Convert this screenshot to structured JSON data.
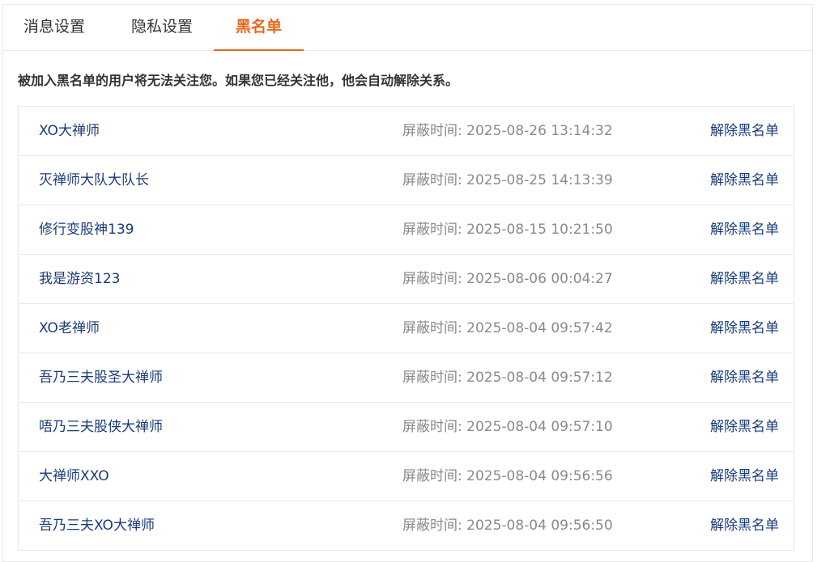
{
  "tabs": [
    {
      "label": "消息设置",
      "active": false
    },
    {
      "label": "隐私设置",
      "active": false
    },
    {
      "label": "黑名单",
      "active": true
    }
  ],
  "notice": "被加入黑名单的用户将无法关注您。如果您已经关注他，他会自动解除关系。",
  "time_prefix": "屏蔽时间:",
  "unblock_label": "解除黑名单",
  "colors": {
    "accent": "#e8681c",
    "link": "#1a3b78",
    "muted": "#8a8a8a",
    "border": "#e8e8e8"
  },
  "blacklist": [
    {
      "name": "XO大禅师",
      "time": "屏蔽时间:  2025-08-26 13:14:32",
      "action": "解除黑名单"
    },
    {
      "name": "灭禅师大队大队长",
      "time": "屏蔽时间:  2025-08-25 14:13:39",
      "action": "解除黑名单"
    },
    {
      "name": "修行变股神139",
      "time": "屏蔽时间:  2025-08-15 10:21:50",
      "action": "解除黑名单"
    },
    {
      "name": "我是游资123",
      "time": "屏蔽时间:  2025-08-06 00:04:27",
      "action": "解除黑名单"
    },
    {
      "name": "XO老禅师",
      "time": "屏蔽时间:  2025-08-04 09:57:42",
      "action": "解除黑名单"
    },
    {
      "name": "吾乃三夫股圣大禅师",
      "time": "屏蔽时间:  2025-08-04 09:57:12",
      "action": "解除黑名单"
    },
    {
      "name": "唔乃三夫股侠大禅师",
      "time": "屏蔽时间:  2025-08-04 09:57:10",
      "action": "解除黑名单"
    },
    {
      "name": "大禅师XXO",
      "time": "屏蔽时间:  2025-08-04 09:56:56",
      "action": "解除黑名单"
    },
    {
      "name": "吾乃三夫XO大禅师",
      "time": "屏蔽时间:  2025-08-04 09:56:50",
      "action": "解除黑名单"
    }
  ]
}
